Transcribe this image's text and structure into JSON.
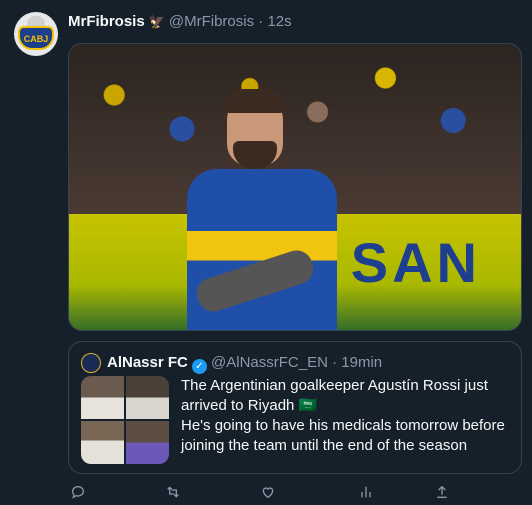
{
  "tweet": {
    "display_name": "MrFibrosis",
    "handle": "@MrFibrosis",
    "separator": "·",
    "time": "12s",
    "media_banner_text": "SAN"
  },
  "avatar": {
    "badge_text": "CABJ"
  },
  "quoted": {
    "display_name": "AlNassr FC",
    "handle": "@AlNassrFC_EN",
    "separator": "·",
    "time": "19min",
    "text_line1": "The Argentinian goalkeeper Agustín Rossi just arrived to Riyadh 🇸🇦",
    "text_line2": "He's going to have his medicals tomorrow before joining the team until the end of the season"
  },
  "actions": {
    "reply_icon": "reply-icon",
    "retweet_icon": "retweet-icon",
    "like_icon": "like-icon",
    "analytics_icon": "analytics-icon",
    "share_icon": "share-icon"
  },
  "colors": {
    "background": "#15202b",
    "text": "#f7f9f9",
    "muted": "#8b98a5",
    "border": "#38444d",
    "verified": "#1d9bf0"
  }
}
